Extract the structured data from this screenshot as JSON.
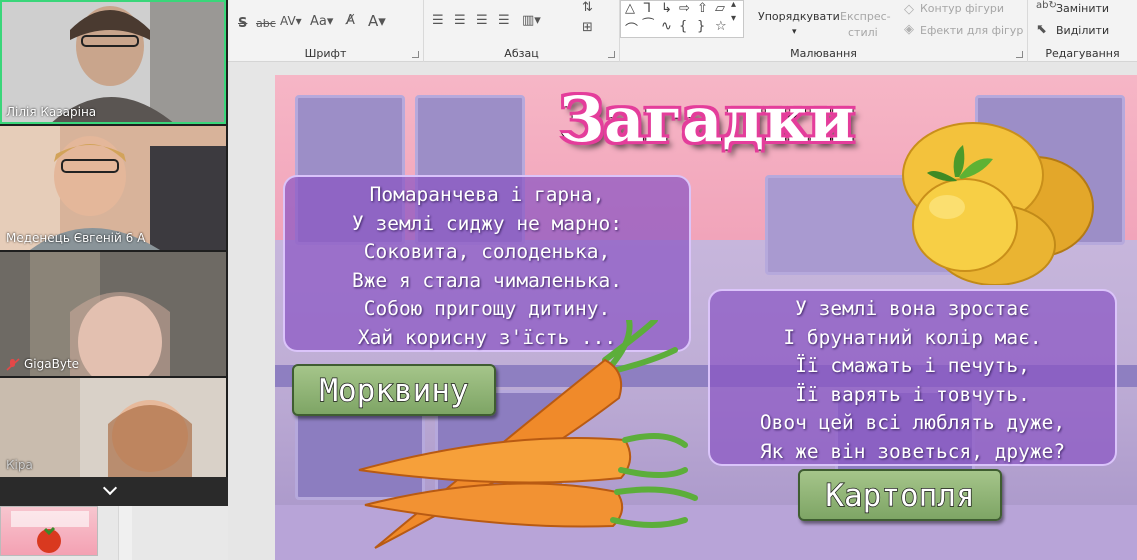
{
  "ribbon": {
    "groups": {
      "font": "Шрифт",
      "paragraph": "Абзац",
      "drawing": "Малювання",
      "editing": "Редагування"
    },
    "drawing": {
      "arrange": "Упорядкувати",
      "quick_styles_1": "Експрес-",
      "quick_styles_2": "стилі",
      "shape_outline": "Контур фігури",
      "shape_effects": "Ефекти для фігур"
    },
    "editing": {
      "replace": "Замінити",
      "select": "Виділити"
    }
  },
  "participants": [
    {
      "name": "Лілія Казаріна",
      "muted": false
    },
    {
      "name": "Меденець Євгеній 6 А",
      "muted": false
    },
    {
      "name": "GigaByte",
      "muted": true
    },
    {
      "name": "Кіра",
      "muted": false
    }
  ],
  "slide": {
    "title": "Загадки",
    "riddle1": {
      "lines": [
        "Помаранчева і гарна,",
        "У землі сиджу не марно:",
        "Соковита, солоденька,",
        "Вже я стала чималенька.",
        "Собою пригощу дитину.",
        "Хай корисну з'їсть ..."
      ],
      "answer": "Морквину"
    },
    "riddle2": {
      "lines": [
        "У землі вона зростає",
        "І брунатний колір має.",
        "Її смажать і печуть,",
        "Її варять і товчуть.",
        "Овоч цей всі люблять дуже,",
        "Як же він зоветься, друже?"
      ],
      "answer": "Картопля"
    }
  },
  "colors": {
    "active_speaker": "#3ad67a",
    "title_glow": "#e43d9b",
    "riddle_box": "#8a56c4",
    "answer_button": "#8fb574"
  }
}
